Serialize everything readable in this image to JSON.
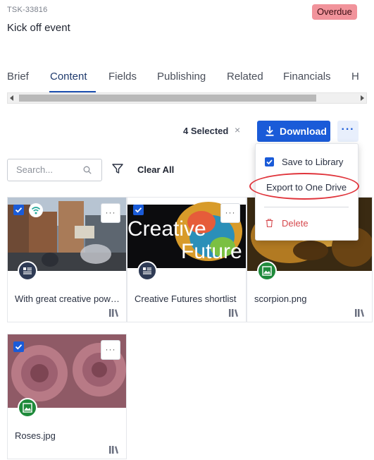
{
  "task": {
    "id": "TSK-33816",
    "status": "Overdue",
    "title": "Kick off event"
  },
  "tabs": [
    {
      "label": "Brief"
    },
    {
      "label": "Content"
    },
    {
      "label": "Fields"
    },
    {
      "label": "Publishing"
    },
    {
      "label": "Related"
    },
    {
      "label": "Financials"
    },
    {
      "label": "H"
    }
  ],
  "toolbar": {
    "selected_label": "4 Selected",
    "clear_symbol": "×",
    "download_label": "Download",
    "more_symbol": "···"
  },
  "filters": {
    "search_placeholder": "Search...",
    "clear_all_label": "Clear All"
  },
  "menu": {
    "save_label": "Save to Library",
    "export_label": "Export to One Drive",
    "delete_label": "Delete"
  },
  "assets": [
    {
      "name": "With great creative power comes great responsibility",
      "type": "doc",
      "selected": true
    },
    {
      "name": "Creative Futures shortlist",
      "type": "doc",
      "selected": true,
      "thumb_text_1": "Creative",
      "thumb_text_2": "Future"
    },
    {
      "name": "scorpion.png",
      "type": "img",
      "selected": true
    },
    {
      "name": "Roses.jpg",
      "type": "img",
      "selected": true
    }
  ],
  "kebab_symbol": "···",
  "colors": {
    "accent": "#1a5bd8",
    "overdue": "#f1939b",
    "delete": "#d6484d",
    "highlight": "#e0353c"
  }
}
